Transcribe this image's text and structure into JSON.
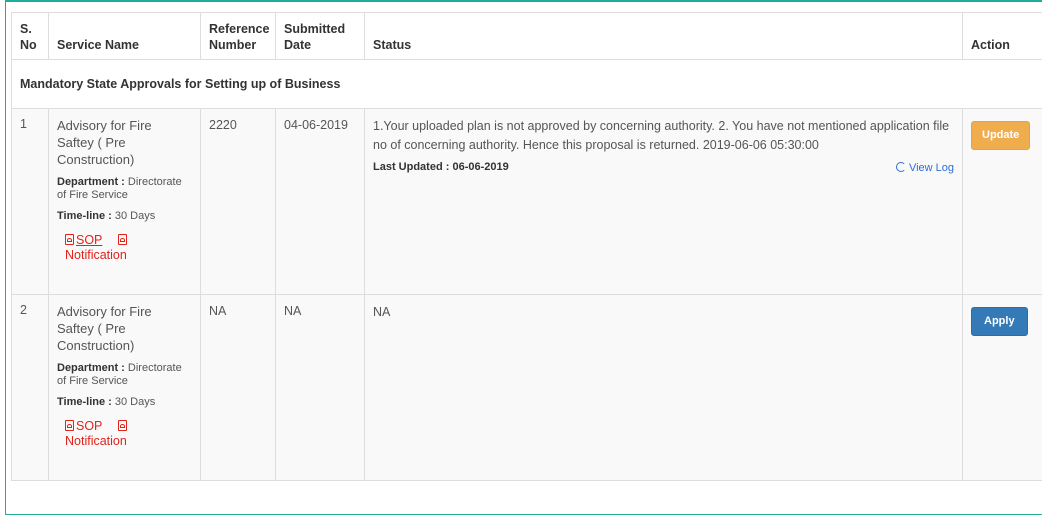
{
  "table": {
    "headers": {
      "sno": "S. No",
      "service": "Service Name",
      "reference": "Reference Number",
      "submitted": "Submitted Date",
      "status": "Status",
      "action": "Action"
    },
    "group_title": "Mandatory State Approvals for Setting up of Business",
    "rows": [
      {
        "sno": "1",
        "service_name": "Advisory for Fire Saftey ( Pre Construction)",
        "department_label": "Department :",
        "department": "Directorate of Fire Service",
        "timeline_label": "Time-line :",
        "timeline": "30 Days",
        "sop_label": "SOP",
        "notification_label": "Notification",
        "reference": "2220",
        "submitted": "04-06-2019",
        "status": "1.Your uploaded plan is not approved by concerning authority. 2. You have not mentioned application file no of concerning authority. Hence this proposal is returned. 2019-06-06 05:30:00",
        "last_updated_label": "Last Updated :",
        "last_updated": "06-06-2019",
        "view_log_label": "View Log",
        "action_label": "Update"
      },
      {
        "sno": "2",
        "service_name": "Advisory for Fire Saftey ( Pre Construction)",
        "department_label": "Department :",
        "department": "Directorate of Fire Service",
        "timeline_label": "Time-line :",
        "timeline": "30 Days",
        "sop_label": "SOP",
        "notification_label": "Notification",
        "reference": "NA",
        "submitted": "NA",
        "status": "NA",
        "action_label": "Apply"
      }
    ]
  },
  "colors": {
    "accent": "#1fae9b",
    "link_red": "#e2231a",
    "link_blue": "#2a6fd3",
    "update_button": "#f0ad4e",
    "apply_button": "#337ab7"
  }
}
